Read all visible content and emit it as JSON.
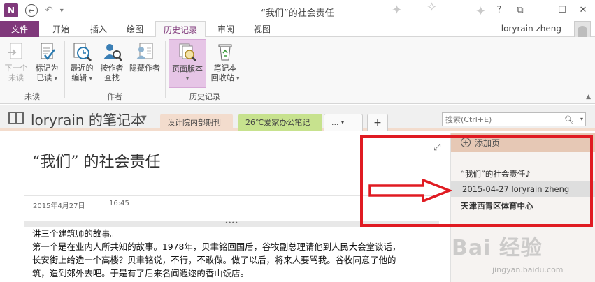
{
  "window": {
    "title": "“我们”的社会责任",
    "app_logo": "N",
    "controls": [
      "?",
      "⧉",
      "—",
      "☐",
      "✕"
    ]
  },
  "ribbon": {
    "file_tab": "文件",
    "tabs": [
      "开始",
      "插入",
      "绘图",
      "历史记录",
      "审阅",
      "视图"
    ],
    "active_tab": "历史记录",
    "user": "loryrain zheng",
    "buttons": {
      "next_unread": [
        "下一个",
        "未读"
      ],
      "mark_read": [
        "标记为",
        "已读"
      ],
      "recent_edits": [
        "最近的",
        "编辑"
      ],
      "by_author": [
        "按作者",
        "查找"
      ],
      "hide_authors": "隐藏作者",
      "page_versions": "页面版本",
      "recycle_bin": [
        "笔记本",
        "回收站"
      ]
    },
    "groups": {
      "unread": "未读",
      "authors": "作者",
      "history": "历史记录"
    }
  },
  "notebook": {
    "title": "loryrain 的笔记本",
    "sections": [
      "设计院内部期刊",
      "26℃爱家办公笔记",
      "...",
      "+"
    ],
    "search_placeholder": "搜索(Ctrl+E)"
  },
  "page": {
    "title": "“我们” 的社会责任",
    "date": "2015年4月27日",
    "time": "16:45",
    "lines": [
      "讲三个建筑师的故事。",
      "第一个是在业内人所共知的故事。1978年，贝聿铭回国后，谷牧副总理请他到人民大会堂谈话，",
      "长安街上给造一个高楼？贝聿铭说，不行，不敢做。做了以后，将来人要骂我。谷牧同意了他的",
      "筑，造到郊外去吧。于是有了后来名闻遐迩的香山饭店。"
    ]
  },
  "page_list": {
    "add_page": "添加页",
    "items": [
      "“我们”的社会责任♪",
      "2015-04-27 loryrain zheng",
      "天津西青区体育中心"
    ]
  },
  "watermark": {
    "main": "Bai 经验",
    "sub": "jingyan.baidu.com"
  },
  "colors": {
    "accent": "#80397b",
    "annotation": "#e01b22",
    "section1": "#f3dccd",
    "section2": "#c7e28e"
  }
}
